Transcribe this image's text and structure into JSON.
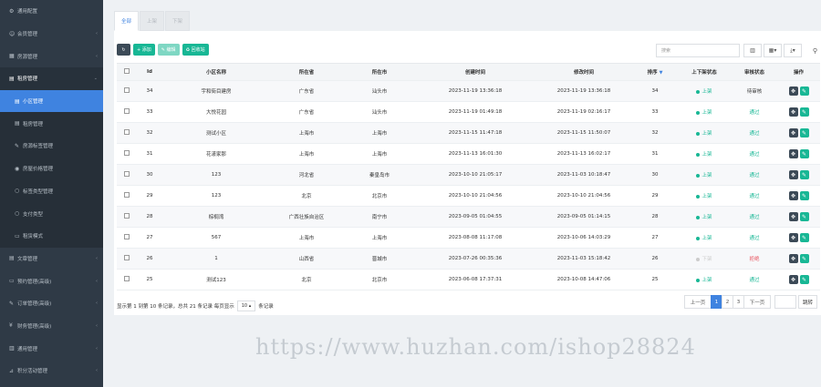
{
  "sidebar": {
    "items": [
      {
        "icon": "⚙",
        "label": "通用配置",
        "chev": "",
        "type": "top"
      },
      {
        "icon": "☺",
        "label": "会员管理",
        "chev": "‹",
        "type": "top"
      },
      {
        "icon": "▦",
        "label": "房源管理",
        "chev": "‹",
        "type": "top"
      },
      {
        "icon": "▤",
        "label": "租房管理",
        "chev": "⌄",
        "type": "open"
      },
      {
        "icon": "▤",
        "label": "小区管理",
        "chev": "",
        "type": "active"
      },
      {
        "icon": "▤",
        "label": "租房管理",
        "chev": "",
        "type": "sub"
      },
      {
        "icon": "✎",
        "label": "房源标签管理",
        "chev": "",
        "type": "sub"
      },
      {
        "icon": "◉",
        "label": "房屋价格管理",
        "chev": "",
        "type": "sub"
      },
      {
        "icon": "○",
        "label": "标签类型管理",
        "chev": "",
        "type": "sub"
      },
      {
        "icon": "○",
        "label": "支付类型",
        "chev": "",
        "type": "sub"
      },
      {
        "icon": "▭",
        "label": "租赁模式",
        "chev": "",
        "type": "sub"
      },
      {
        "icon": "▤",
        "label": "文章管理",
        "chev": "‹",
        "type": "top"
      },
      {
        "icon": "▭",
        "label": "预约管理(高级)",
        "chev": "‹",
        "type": "top"
      },
      {
        "icon": "✎",
        "label": "订单管理(高级)",
        "chev": "‹",
        "type": "top"
      },
      {
        "icon": "¥",
        "label": "财务管理(高级)",
        "chev": "‹",
        "type": "top"
      },
      {
        "icon": "▥",
        "label": "通用管理",
        "chev": "‹",
        "type": "top"
      },
      {
        "icon": "⊿",
        "label": "积分活动管理",
        "chev": "‹",
        "type": "top"
      }
    ]
  },
  "tabs": [
    "全部",
    "上架",
    "下架"
  ],
  "toolbar": {
    "refresh_icon": "↻",
    "add_label": "+ 添加",
    "edit_label": "✎ 编辑",
    "recycle_label": "♻ 回收站"
  },
  "search": {
    "placeholder": "搜索"
  },
  "tools": {
    "table_icon": "▥",
    "columns_icon": "▦▾",
    "export_icon": "⤓▾",
    "search_icon": "⚲"
  },
  "table": {
    "headers": [
      "",
      "Id",
      "小区名称",
      "所在省",
      "所在市",
      "创建时间",
      "修改时间",
      "排序",
      "上下架状态",
      "审核状态",
      "操作"
    ],
    "rows": [
      {
        "id": "34",
        "name": "宇和街目建房",
        "province": "广东省",
        "city": "汕头市",
        "created": "2023-11-19 13:36:18",
        "updated": "2023-11-19 13:36:18",
        "sort": "34",
        "status": "上架",
        "audit": "待审核",
        "audit_type": "pending"
      },
      {
        "id": "33",
        "name": "大悦花园",
        "province": "广东省",
        "city": "汕头市",
        "created": "2023-11-19 01:49:18",
        "updated": "2023-11-19 02:16:17",
        "sort": "33",
        "status": "上架",
        "audit": "通过",
        "audit_type": "pass"
      },
      {
        "id": "32",
        "name": "测试小区",
        "province": "上海市",
        "city": "上海市",
        "created": "2023-11-15 11:47:18",
        "updated": "2023-11-15 11:50:07",
        "sort": "32",
        "status": "上架",
        "audit": "通过",
        "audit_type": "pass"
      },
      {
        "id": "31",
        "name": "花漾家那",
        "province": "上海市",
        "city": "上海市",
        "created": "2023-11-13 16:01:30",
        "updated": "2023-11-13 16:02:17",
        "sort": "31",
        "status": "上架",
        "audit": "通过",
        "audit_type": "pass"
      },
      {
        "id": "30",
        "name": "123",
        "province": "河北省",
        "city": "秦皇岛市",
        "created": "2023-10-10 21:05:17",
        "updated": "2023-11-03 10:18:47",
        "sort": "30",
        "status": "上架",
        "audit": "通过",
        "audit_type": "pass"
      },
      {
        "id": "29",
        "name": "123",
        "province": "北京",
        "city": "北京市",
        "created": "2023-10-10 21:04:56",
        "updated": "2023-10-10 21:04:56",
        "sort": "29",
        "status": "上架",
        "audit": "通过",
        "audit_type": "pass"
      },
      {
        "id": "28",
        "name": "棕榈湾",
        "province": "广西壮族自治区",
        "city": "南宁市",
        "created": "2023-09-05 01:04:55",
        "updated": "2023-09-05 01:14:15",
        "sort": "28",
        "status": "上架",
        "audit": "通过",
        "audit_type": "pass"
      },
      {
        "id": "27",
        "name": "567",
        "province": "上海市",
        "city": "上海市",
        "created": "2023-08-08 11:17:08",
        "updated": "2023-10-06 14:03:29",
        "sort": "27",
        "status": "上架",
        "audit": "通过",
        "audit_type": "pass"
      },
      {
        "id": "26",
        "name": "1",
        "province": "山西省",
        "city": "晋城市",
        "created": "2023-07-26 00:35:36",
        "updated": "2023-11-03 15:18:42",
        "sort": "26",
        "status": "下架",
        "audit": "拒绝",
        "audit_type": "reject"
      },
      {
        "id": "25",
        "name": "测试123",
        "province": "北京",
        "city": "北京市",
        "created": "2023-06-08 17:37:31",
        "updated": "2023-10-08 14:47:06",
        "sort": "25",
        "status": "上架",
        "audit": "通过",
        "audit_type": "pass"
      }
    ]
  },
  "pager_info": {
    "text1": "显示第 1 到第 10 条记录，总共 21 条记录 每页显示",
    "page_size": "10 ▴",
    "text2": "条记录"
  },
  "pager": {
    "prev": "上一页",
    "pages": [
      "1",
      "2",
      "3"
    ],
    "next": "下一页",
    "jump": "跳转"
  },
  "watermark": "https://www.huzhan.com/ishop28824",
  "colors": {
    "accent": "#3f83e0",
    "green": "#18b795",
    "reject": "#e8505b"
  }
}
